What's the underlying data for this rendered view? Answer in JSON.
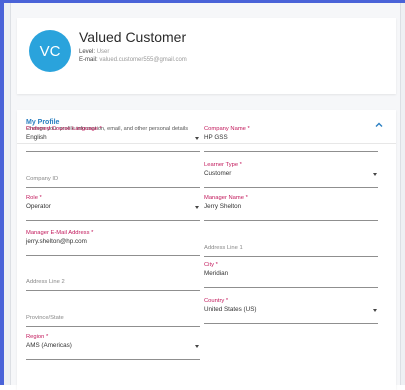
{
  "profile": {
    "initials": "VC",
    "name": "Valued Customer",
    "level_key": "Level:",
    "level_value": "User",
    "email_key": "E-mail:",
    "email_value": "valued.customer555@gmail.com",
    "avatar_color": "#2aa3dc"
  },
  "section": {
    "title": "My Profile",
    "subtitle": "Change your profile information, email, and other personal details"
  },
  "fields": {
    "course_language": {
      "label": "Preferred Course Language *",
      "value": "English"
    },
    "company_name": {
      "label": "Company Name *",
      "value": "HP GSS"
    },
    "company_id": {
      "placeholder": "Company ID"
    },
    "learner_type": {
      "label": "Learner Type *",
      "value": "Customer"
    },
    "role": {
      "label": "Role *",
      "value": "Operator"
    },
    "manager_name": {
      "label": "Manager Name *",
      "value": "Jerry Shelton"
    },
    "manager_email": {
      "label": "Manager E-Mail Address *",
      "value": "jerry.shelton@hp.com"
    },
    "address1": {
      "placeholder": "Address Line 1"
    },
    "address2": {
      "placeholder": "Address Line 2"
    },
    "city": {
      "label": "City *",
      "value": "Meridian"
    },
    "province": {
      "placeholder": "Province/State"
    },
    "country": {
      "label": "Country *",
      "value": "United States (US)"
    },
    "region": {
      "label": "Region *",
      "value": "AMS (Americas)"
    }
  },
  "icons": {
    "collapse": "chevron-up-icon",
    "dropdown": "caret-down-icon"
  },
  "colors": {
    "accent": "#2a7fc1",
    "required_label": "#c2185b",
    "frame": "#4a63d8"
  }
}
